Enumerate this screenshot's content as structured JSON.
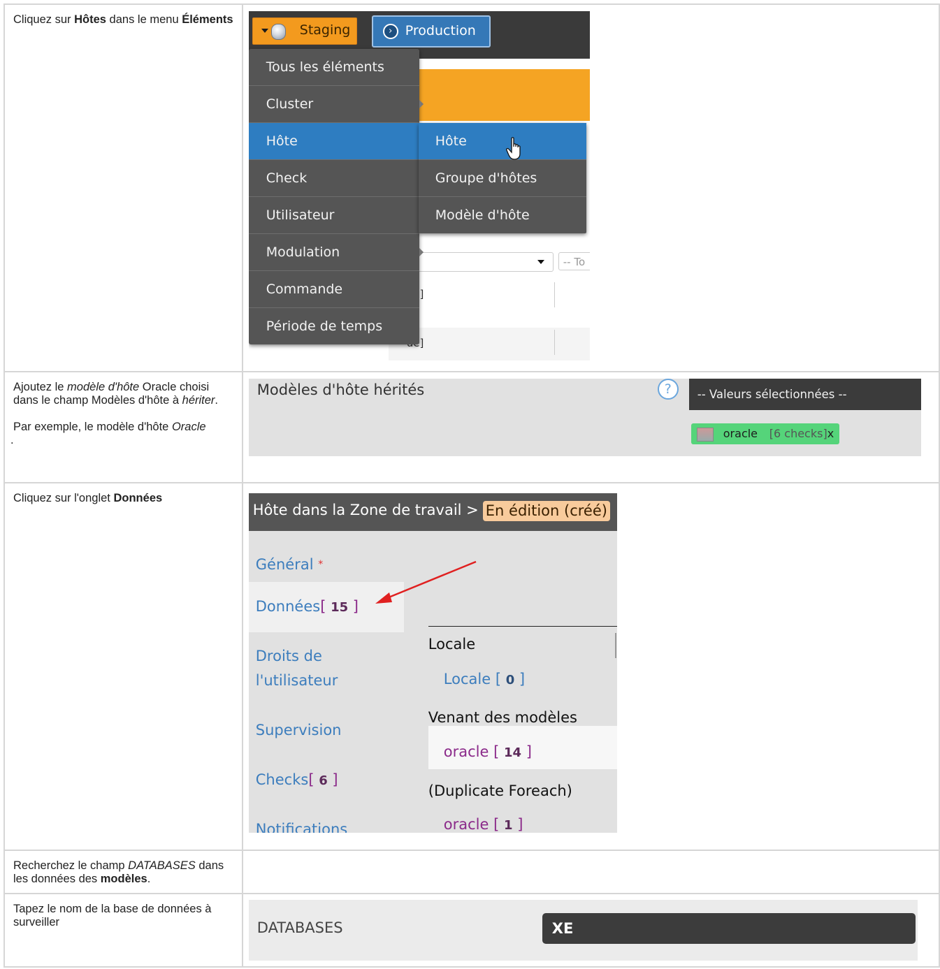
{
  "rows": [
    {
      "instruction": {
        "prefix": "Cliquez sur ",
        "bold1": "Hôtes",
        "middle": " dans le menu ",
        "bold2": "Éléments"
      }
    },
    {
      "instruction": {
        "p1_a": "Ajoutez le ",
        "p1_i1": "modèle d'hôte",
        "p1_b": " Oracle choisi dans le champ Modèles d'hôte à ",
        "p1_i2": "hériter",
        "p1_c": ".",
        "p2_a": "Par exemple, le modèle d'hôte ",
        "p2_i": "Oracle",
        "p2_b": " ."
      }
    },
    {
      "instruction": {
        "prefix": "Cliquez sur l'onglet ",
        "bold": "Données"
      }
    },
    {
      "instruction": {
        "a": "Recherchez le champ ",
        "i": "DATABASES",
        "b": " dans les données des ",
        "bold": "modèles",
        "c": "."
      }
    },
    {
      "instruction": {
        "text": "Tapez le nom de la base de données à surveiller"
      }
    }
  ],
  "screen1": {
    "staging_label": "Staging",
    "production_label": "Production",
    "menu_items": [
      "Tous les éléments",
      "Cluster",
      "Hôte",
      "Check",
      "Utilisateur",
      "Modulation",
      "Commande",
      "Période de temps"
    ],
    "active_item": "Hôte",
    "submenu_items": [
      "Hôte",
      "Groupe d'hôtes",
      "Modèle d'hôte"
    ],
    "filter_placeholder": "-- To",
    "cell_text_1": "ué]",
    "cell_text_2": "ué]",
    "icons": [
      "caret-down-icon",
      "database-icon",
      "circle-arrow-right-icon",
      "hand-pointer-icon"
    ]
  },
  "screen2": {
    "title": "Modèles d'hôte hérités",
    "help_icon": "?",
    "header": "-- Valeurs sélectionnées --",
    "tag_name": "oracle",
    "tag_checks": "[6 checks]",
    "tag_remove": "x"
  },
  "screen3": {
    "breadcrumb": "Hôte dans la Zone de travail >",
    "status_badge": "En édition (créé)",
    "nav": {
      "general": "Général",
      "general_required": "*",
      "donnees": "Données",
      "donnees_count": "15",
      "droits_line1": "Droits de",
      "droits_line2": "l'utilisateur",
      "supervision": "Supervision",
      "checks": "Checks",
      "checks_count": "6",
      "notifications": "Notifications"
    },
    "right": {
      "locale_heading": "Locale",
      "locale_item": "Locale",
      "locale_count": "0",
      "models_heading": "Venant des modèles",
      "models_item": "oracle",
      "models_count": "14",
      "dup_heading": "(Duplicate Foreach)",
      "dup_item": "oracle",
      "dup_count": "1"
    },
    "accent_colors": {
      "link": "#3c7dbd",
      "bracket": "#8b2a8a",
      "badge": "#f8cb9c",
      "arrow": "#e02020"
    }
  },
  "screen5": {
    "label": "DATABASES",
    "value": "XE"
  }
}
